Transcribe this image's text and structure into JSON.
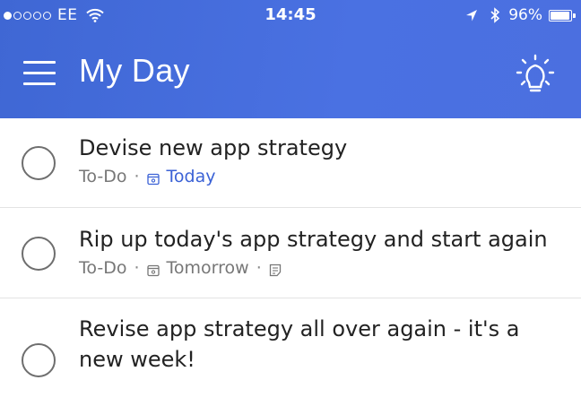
{
  "status_bar": {
    "carrier": "EE",
    "time": "14:45",
    "battery": "96%",
    "battery_level": 0.96,
    "signal_bars_filled": 1,
    "signal_bars_total": 5
  },
  "header": {
    "title": "My Day",
    "menu_icon": "hamburger-menu-icon",
    "suggestions_icon": "lightbulb-icon",
    "background_color": "#4a6fe0"
  },
  "tasks": [
    {
      "title": "Devise new app strategy",
      "list": "To-Do",
      "separator": "·",
      "due": "Today",
      "due_color": "#3b62d6",
      "has_note": false
    },
    {
      "title": "Rip up today's app strategy and start again",
      "list": "To-Do",
      "separator": "·",
      "due": "Tomorrow",
      "has_note": true
    },
    {
      "title": "Revise app strategy all over again - it's a new week!",
      "list": "",
      "separator": "",
      "due": "",
      "has_note": false
    }
  ]
}
